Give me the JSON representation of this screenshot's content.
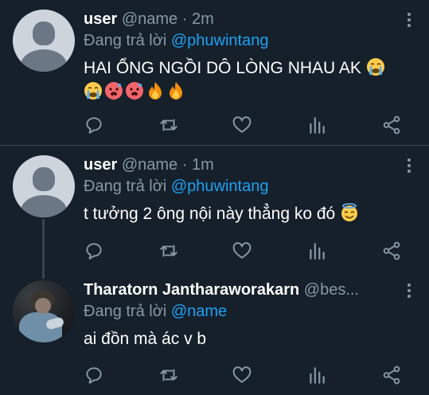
{
  "tweets": [
    {
      "name": "user",
      "handle": "@name",
      "dot": "·",
      "time": "2m",
      "replying_prefix": "Đang trả lời ",
      "replying_to": "@phuwintang",
      "text": "HAI ỔNG NGỒI DÔ LÒNG NHAU AK",
      "emojis_line1": [
        "crying-face"
      ],
      "emojis_line2": [
        "crying-face",
        "hot-face",
        "hot-face",
        "fire",
        "fire"
      ]
    },
    {
      "name": "user",
      "handle": "@name",
      "dot": "·",
      "time": "1m",
      "replying_prefix": "Đang trả lời ",
      "replying_to": "@phuwintang",
      "text": "t tưởng 2 ông nội này thẳng ko đó",
      "emojis_line1": [
        "halo-face"
      ]
    },
    {
      "name": "Tharatorn Jantharaworakarn",
      "handle": "@bes...",
      "replying_prefix": "Đang trả lời ",
      "replying_to": "@name",
      "text": "ai đồn mà ác v b"
    }
  ],
  "action_icons": [
    "reply-icon",
    "retweet-icon",
    "like-icon",
    "analytics-icon",
    "share-icon"
  ],
  "colors": {
    "background": "#15202b",
    "secondary_text": "#8899a6",
    "link": "#1da1f2",
    "divider": "#38444d"
  }
}
